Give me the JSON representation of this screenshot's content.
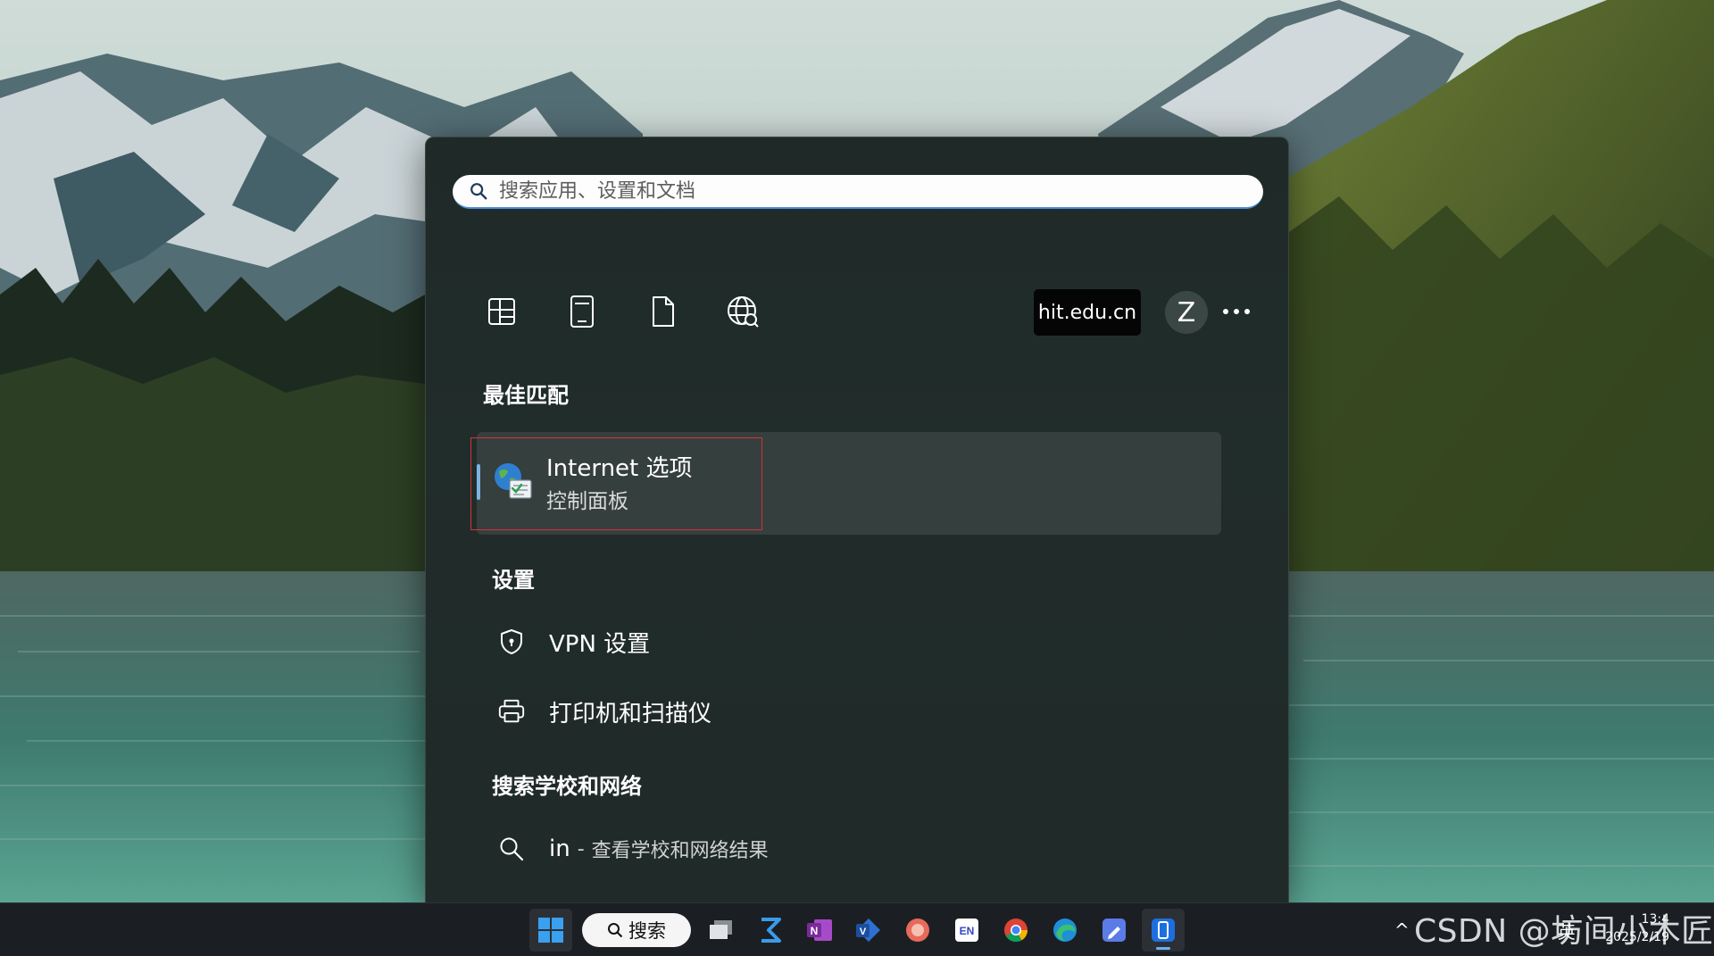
{
  "search": {
    "placeholder": "搜索应用、设置和文档"
  },
  "filters": [
    {
      "name": "apps-filter",
      "icon": "apps-grid-icon"
    },
    {
      "name": "documents-filter",
      "icon": "tablet-icon"
    },
    {
      "name": "files-filter",
      "icon": "document-icon"
    },
    {
      "name": "web-filter",
      "icon": "globe-icon"
    }
  ],
  "account": {
    "domain": "hit.edu.cn",
    "avatar_letter": "Z"
  },
  "best_match": {
    "heading": "最佳匹配",
    "title": "Internet 选项",
    "subtitle": "控制面板"
  },
  "settings": {
    "heading": "设置",
    "items": [
      {
        "label": "VPN 设置",
        "icon": "shield-icon"
      },
      {
        "label": "打印机和扫描仪",
        "icon": "printer-icon"
      }
    ]
  },
  "school_search": {
    "heading": "搜索学校和网络",
    "query": "in",
    "separator": "-",
    "description": "查看学校和网络结果"
  },
  "taskbar": {
    "search_label": "搜索",
    "apps": [
      "start",
      "task-view",
      "powershell",
      "onenote",
      "visio",
      "app-red",
      "en-translator",
      "chrome",
      "edge",
      "notes",
      "phone-link"
    ]
  },
  "tray": {
    "ime": "英",
    "time": "13:4",
    "date": "2025/2/19"
  },
  "watermark": "CSDN @坊间小木匠"
}
